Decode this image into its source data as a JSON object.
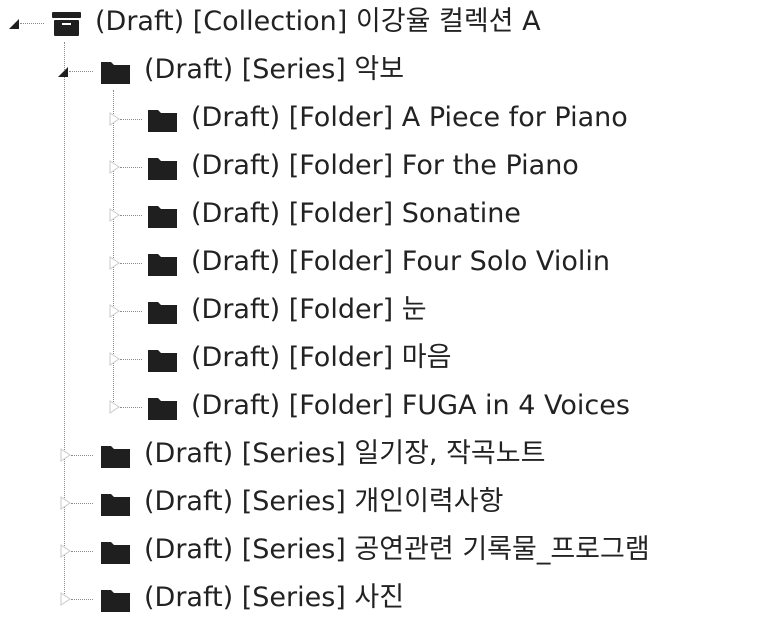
{
  "tree": {
    "root": {
      "label": "(Draft) [Collection] 이강율 컬렉션 A",
      "icon": "archive-box-icon",
      "expanded": true
    },
    "series_music": {
      "label": "(Draft) [Series] 악보",
      "icon": "folder-icon",
      "expanded": true
    },
    "folders": [
      {
        "label": "(Draft) [Folder] A Piece for Piano",
        "icon": "folder-icon",
        "expanded": false
      },
      {
        "label": "(Draft) [Folder] For the Piano",
        "icon": "folder-icon",
        "expanded": false
      },
      {
        "label": "(Draft) [Folder] Sonatine",
        "icon": "folder-icon",
        "expanded": false
      },
      {
        "label": "(Draft) [Folder] Four Solo Violin",
        "icon": "folder-icon",
        "expanded": false
      },
      {
        "label": "(Draft) [Folder] 눈",
        "icon": "folder-icon",
        "expanded": false
      },
      {
        "label": "(Draft) [Folder] 마음",
        "icon": "folder-icon",
        "expanded": false
      },
      {
        "label": "(Draft) [Folder] FUGA in 4 Voices",
        "icon": "folder-icon",
        "expanded": false
      }
    ],
    "other_series": [
      {
        "label": "(Draft) [Series] 일기장, 작곡노트",
        "icon": "folder-icon",
        "expanded": false
      },
      {
        "label": "(Draft) [Series] 개인이력사항",
        "icon": "folder-icon",
        "expanded": false
      },
      {
        "label": "(Draft) [Series] 공연관련 기록물_프로그램",
        "icon": "folder-icon",
        "expanded": false
      },
      {
        "label": "(Draft) [Series] 사진",
        "icon": "folder-icon",
        "expanded": false
      }
    ]
  },
  "colors": {
    "icon": "#1f1f1f",
    "text": "#222222",
    "tree_line": "#8a8a8a",
    "collapsed_toggle": "#c9c9c9",
    "expanded_toggle": "#1f1f1f"
  }
}
